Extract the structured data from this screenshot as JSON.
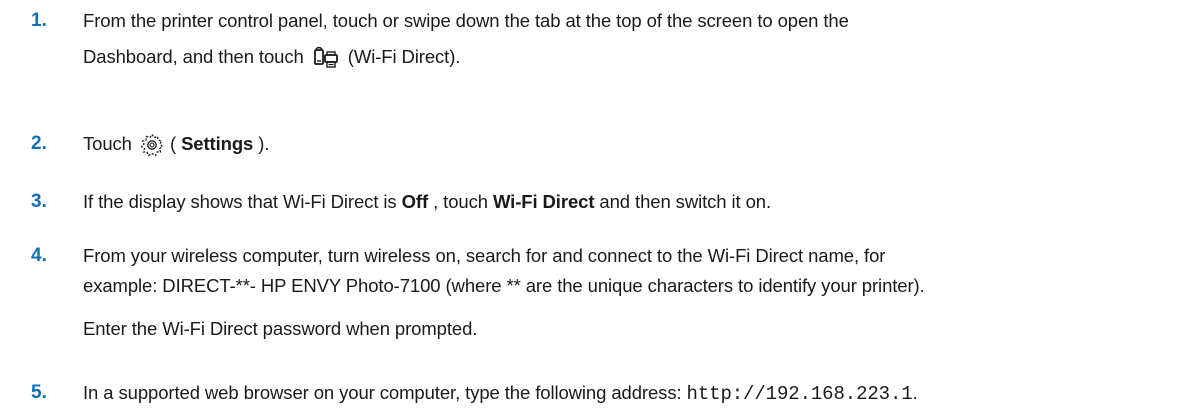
{
  "steps": [
    {
      "number": "1.",
      "line1": "From the printer control panel, touch or swipe down the tab at the top of the screen to open the",
      "line2_before": "Dashboard, and then touch ",
      "line2_after": " (Wi-Fi Direct).",
      "icon": "wifi-direct-icon"
    },
    {
      "number": "2.",
      "before": "Touch ",
      "paren_open": " ( ",
      "bold": "Settings",
      "after": " ).",
      "icon": "gear-icon"
    },
    {
      "number": "3.",
      "before": "If the display shows that Wi-Fi Direct is ",
      "bold1": "Off",
      "middle": " , touch ",
      "bold2": "Wi-Fi Direct",
      "after": " and then switch it on."
    },
    {
      "number": "4.",
      "line1": "From your wireless computer, turn wireless on, search for and connect to the Wi-Fi Direct name, for",
      "line2": "example: DIRECT-**- HP ENVY Photo-7100 (where ** are the unique characters to identify your printer).",
      "note": "Enter the Wi-Fi Direct password when prompted."
    },
    {
      "number": "5.",
      "before": "In a supported web browser on your computer, type the following address: ",
      "code": "http://192.168.223.1",
      "after": "."
    }
  ],
  "colors": {
    "step_number": "#0f6fb7",
    "text": "#1a1a1a"
  }
}
